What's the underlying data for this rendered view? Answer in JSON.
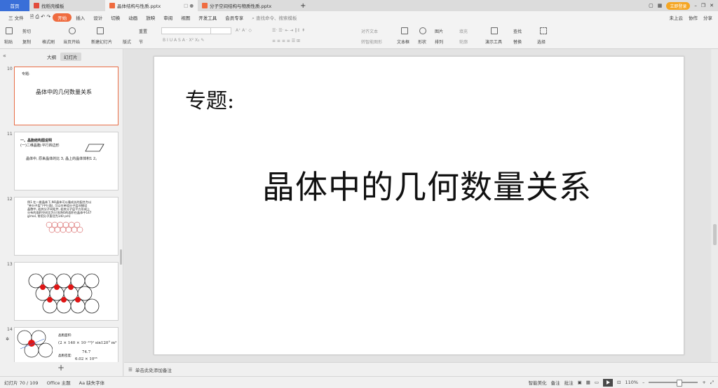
{
  "titlebar": {
    "home": "首页",
    "tabs": [
      {
        "label": "找稻壳模板",
        "color": "#e24b3b"
      },
      {
        "label": "晶体结构与性质.pptx",
        "color": "#ef6b3f"
      },
      {
        "label": "分子空间结构与物质性质.pptx",
        "color": "#ef6b3f"
      }
    ],
    "vip": "立即登录",
    "add": "+"
  },
  "menubar": {
    "file": "三 文件",
    "start": "开始",
    "items": [
      "插入",
      "设计",
      "切换",
      "动画",
      "放映",
      "审阅",
      "视图",
      "开发工具",
      "会员专享"
    ],
    "search": "查找命令、搜索模板",
    "cloud": "未上云",
    "collab": "协作",
    "share": "分享"
  },
  "ribbon": {
    "paste": "粘贴",
    "cut": "剪切",
    "copy": "复制",
    "format_painter": "格式刷",
    "play_current": "当页开始",
    "new_slide": "新建幻灯片",
    "layout": "版式",
    "section": "节",
    "reset": "重置",
    "align_text": "对齐文本",
    "convert_smartart": "转智能图形",
    "textbox": "文本框",
    "shape": "形状",
    "arrange": "排列",
    "picture": "图片",
    "fill": "填充",
    "outline": "轮廓",
    "presentation_tool": "演示工具",
    "find": "查找",
    "replace": "替换",
    "select": "选择"
  },
  "left_panel": {
    "tab_outline": "大纲",
    "tab_slides": "幻灯片",
    "thumbs": [
      {
        "num": "10",
        "sub": "专题:",
        "title": "晶体中的几何数量关系"
      },
      {
        "num": "11",
        "l1": "一、晶胞结构图说明",
        "l2": "(一)二维晶胞:平行四边形",
        "l3": "晶体中, 原来晶体的比 3, 晶上的晶体体积1 2。"
      },
      {
        "num": "12",
        "l1": "例1 在一维晶体下,NO晶体可以看成长的配合为以",
        "l2": "\"单分子层\"(平行面), 可以在单组分子层间铺设",
        "l3": "晶胞中, 若其分子间距并, 若其分子层平方形成上",
        "l4": "分布的面积空间比为(已知NO的面积在晶体中147",
        "l5": "g/mol, 常用分子直径为140 pm)"
      },
      {
        "num": "13"
      },
      {
        "num": "14",
        "a": "晶胞面积:",
        "b": "(2 × 140 × 10⁻¹⁰)² sin120° m²",
        "c": "晶胞密度:",
        "d": "74.7",
        "e": "6.02 × 10²³"
      }
    ]
  },
  "slide": {
    "subtitle": "专题:",
    "title": "晶体中的几何数量关系"
  },
  "notes": {
    "placeholder": "单击此处添加备注"
  },
  "status": {
    "slide_count": "幻灯片 70 / 109",
    "theme": "Office 主题",
    "font_missing": "缺失字体",
    "smart_beautify": "智能美化",
    "notes": "备注",
    "comments": "批注",
    "zoom": "110%"
  }
}
